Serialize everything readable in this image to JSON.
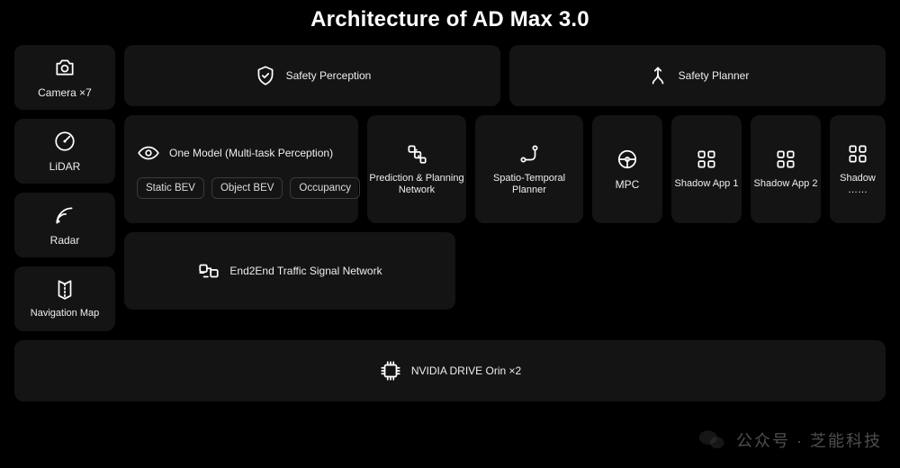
{
  "title": "Architecture of AD Max 3.0",
  "sensors": {
    "camera": "Camera ×7",
    "lidar": "LiDAR",
    "radar": "Radar",
    "nav": "Navigation Map"
  },
  "safety": {
    "perception": "Safety Perception",
    "planner": "Safety Planner"
  },
  "one_model": {
    "title": "One Model (Multi-task Perception)",
    "pills": [
      "Static BEV",
      "Object BEV",
      "Occupancy"
    ]
  },
  "ppn": "Prediction & Planning Network",
  "stp": "Spatio-Temporal Planner",
  "mpc": "MPC",
  "shadow": {
    "app1": "Shadow App 1",
    "app2": "Shadow App 2",
    "more": "Shadow ……"
  },
  "traffic": "End2End Traffic Signal Network",
  "compute": "NVIDIA DRIVE Orin ×2",
  "watermark": "公众号 · 芝能科技"
}
